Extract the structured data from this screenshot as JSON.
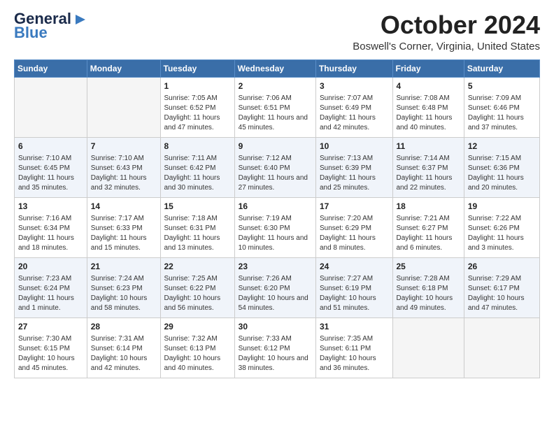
{
  "logo": {
    "line1": "General",
    "line2": "Blue",
    "arrow": "▶"
  },
  "title": "October 2024",
  "location": "Boswell's Corner, Virginia, United States",
  "weekdays": [
    "Sunday",
    "Monday",
    "Tuesday",
    "Wednesday",
    "Thursday",
    "Friday",
    "Saturday"
  ],
  "weeks": [
    [
      {
        "day": "",
        "sunrise": "",
        "sunset": "",
        "daylight": ""
      },
      {
        "day": "",
        "sunrise": "",
        "sunset": "",
        "daylight": ""
      },
      {
        "day": "1",
        "sunrise": "Sunrise: 7:05 AM",
        "sunset": "Sunset: 6:52 PM",
        "daylight": "Daylight: 11 hours and 47 minutes."
      },
      {
        "day": "2",
        "sunrise": "Sunrise: 7:06 AM",
        "sunset": "Sunset: 6:51 PM",
        "daylight": "Daylight: 11 hours and 45 minutes."
      },
      {
        "day": "3",
        "sunrise": "Sunrise: 7:07 AM",
        "sunset": "Sunset: 6:49 PM",
        "daylight": "Daylight: 11 hours and 42 minutes."
      },
      {
        "day": "4",
        "sunrise": "Sunrise: 7:08 AM",
        "sunset": "Sunset: 6:48 PM",
        "daylight": "Daylight: 11 hours and 40 minutes."
      },
      {
        "day": "5",
        "sunrise": "Sunrise: 7:09 AM",
        "sunset": "Sunset: 6:46 PM",
        "daylight": "Daylight: 11 hours and 37 minutes."
      }
    ],
    [
      {
        "day": "6",
        "sunrise": "Sunrise: 7:10 AM",
        "sunset": "Sunset: 6:45 PM",
        "daylight": "Daylight: 11 hours and 35 minutes."
      },
      {
        "day": "7",
        "sunrise": "Sunrise: 7:10 AM",
        "sunset": "Sunset: 6:43 PM",
        "daylight": "Daylight: 11 hours and 32 minutes."
      },
      {
        "day": "8",
        "sunrise": "Sunrise: 7:11 AM",
        "sunset": "Sunset: 6:42 PM",
        "daylight": "Daylight: 11 hours and 30 minutes."
      },
      {
        "day": "9",
        "sunrise": "Sunrise: 7:12 AM",
        "sunset": "Sunset: 6:40 PM",
        "daylight": "Daylight: 11 hours and 27 minutes."
      },
      {
        "day": "10",
        "sunrise": "Sunrise: 7:13 AM",
        "sunset": "Sunset: 6:39 PM",
        "daylight": "Daylight: 11 hours and 25 minutes."
      },
      {
        "day": "11",
        "sunrise": "Sunrise: 7:14 AM",
        "sunset": "Sunset: 6:37 PM",
        "daylight": "Daylight: 11 hours and 22 minutes."
      },
      {
        "day": "12",
        "sunrise": "Sunrise: 7:15 AM",
        "sunset": "Sunset: 6:36 PM",
        "daylight": "Daylight: 11 hours and 20 minutes."
      }
    ],
    [
      {
        "day": "13",
        "sunrise": "Sunrise: 7:16 AM",
        "sunset": "Sunset: 6:34 PM",
        "daylight": "Daylight: 11 hours and 18 minutes."
      },
      {
        "day": "14",
        "sunrise": "Sunrise: 7:17 AM",
        "sunset": "Sunset: 6:33 PM",
        "daylight": "Daylight: 11 hours and 15 minutes."
      },
      {
        "day": "15",
        "sunrise": "Sunrise: 7:18 AM",
        "sunset": "Sunset: 6:31 PM",
        "daylight": "Daylight: 11 hours and 13 minutes."
      },
      {
        "day": "16",
        "sunrise": "Sunrise: 7:19 AM",
        "sunset": "Sunset: 6:30 PM",
        "daylight": "Daylight: 11 hours and 10 minutes."
      },
      {
        "day": "17",
        "sunrise": "Sunrise: 7:20 AM",
        "sunset": "Sunset: 6:29 PM",
        "daylight": "Daylight: 11 hours and 8 minutes."
      },
      {
        "day": "18",
        "sunrise": "Sunrise: 7:21 AM",
        "sunset": "Sunset: 6:27 PM",
        "daylight": "Daylight: 11 hours and 6 minutes."
      },
      {
        "day": "19",
        "sunrise": "Sunrise: 7:22 AM",
        "sunset": "Sunset: 6:26 PM",
        "daylight": "Daylight: 11 hours and 3 minutes."
      }
    ],
    [
      {
        "day": "20",
        "sunrise": "Sunrise: 7:23 AM",
        "sunset": "Sunset: 6:24 PM",
        "daylight": "Daylight: 11 hours and 1 minute."
      },
      {
        "day": "21",
        "sunrise": "Sunrise: 7:24 AM",
        "sunset": "Sunset: 6:23 PM",
        "daylight": "Daylight: 10 hours and 58 minutes."
      },
      {
        "day": "22",
        "sunrise": "Sunrise: 7:25 AM",
        "sunset": "Sunset: 6:22 PM",
        "daylight": "Daylight: 10 hours and 56 minutes."
      },
      {
        "day": "23",
        "sunrise": "Sunrise: 7:26 AM",
        "sunset": "Sunset: 6:20 PM",
        "daylight": "Daylight: 10 hours and 54 minutes."
      },
      {
        "day": "24",
        "sunrise": "Sunrise: 7:27 AM",
        "sunset": "Sunset: 6:19 PM",
        "daylight": "Daylight: 10 hours and 51 minutes."
      },
      {
        "day": "25",
        "sunrise": "Sunrise: 7:28 AM",
        "sunset": "Sunset: 6:18 PM",
        "daylight": "Daylight: 10 hours and 49 minutes."
      },
      {
        "day": "26",
        "sunrise": "Sunrise: 7:29 AM",
        "sunset": "Sunset: 6:17 PM",
        "daylight": "Daylight: 10 hours and 47 minutes."
      }
    ],
    [
      {
        "day": "27",
        "sunrise": "Sunrise: 7:30 AM",
        "sunset": "Sunset: 6:15 PM",
        "daylight": "Daylight: 10 hours and 45 minutes."
      },
      {
        "day": "28",
        "sunrise": "Sunrise: 7:31 AM",
        "sunset": "Sunset: 6:14 PM",
        "daylight": "Daylight: 10 hours and 42 minutes."
      },
      {
        "day": "29",
        "sunrise": "Sunrise: 7:32 AM",
        "sunset": "Sunset: 6:13 PM",
        "daylight": "Daylight: 10 hours and 40 minutes."
      },
      {
        "day": "30",
        "sunrise": "Sunrise: 7:33 AM",
        "sunset": "Sunset: 6:12 PM",
        "daylight": "Daylight: 10 hours and 38 minutes."
      },
      {
        "day": "31",
        "sunrise": "Sunrise: 7:35 AM",
        "sunset": "Sunset: 6:11 PM",
        "daylight": "Daylight: 10 hours and 36 minutes."
      },
      {
        "day": "",
        "sunrise": "",
        "sunset": "",
        "daylight": ""
      },
      {
        "day": "",
        "sunrise": "",
        "sunset": "",
        "daylight": ""
      }
    ]
  ]
}
